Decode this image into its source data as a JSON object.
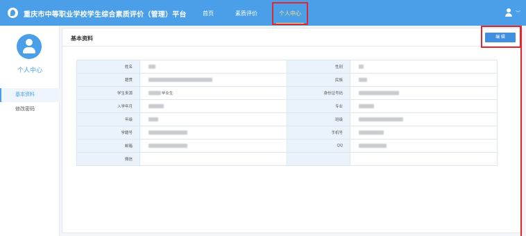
{
  "header": {
    "app_title": "重庆市中等职业学校学生综合素质评价（管理）平台",
    "nav": [
      "首页",
      "素质评价",
      "个人中心"
    ],
    "active_nav": "个人中心",
    "user_icon": "user-icon",
    "caret": "﹀"
  },
  "sidebar": {
    "title": "个人中心",
    "items": [
      {
        "label": "基本资料",
        "active": true
      },
      {
        "label": "修改密码",
        "active": false
      }
    ]
  },
  "main": {
    "section_title": "基本资料",
    "edit_label": "编 辑"
  },
  "profile": {
    "labels_left": [
      "姓名",
      "籍贯",
      "学生来源",
      "入学年月",
      "年级",
      "学籍号",
      "邮箱",
      "微信"
    ],
    "labels_right": [
      "性别",
      "民族",
      "身份证号码",
      "专业",
      "班级",
      "手机号",
      "QQ",
      ""
    ],
    "visible_value": "毕业生"
  },
  "colors": {
    "accent": "#4a9fe8",
    "nav_active": "#ffe07a",
    "highlight": "#e3262a",
    "button": "#3f8fe3"
  }
}
